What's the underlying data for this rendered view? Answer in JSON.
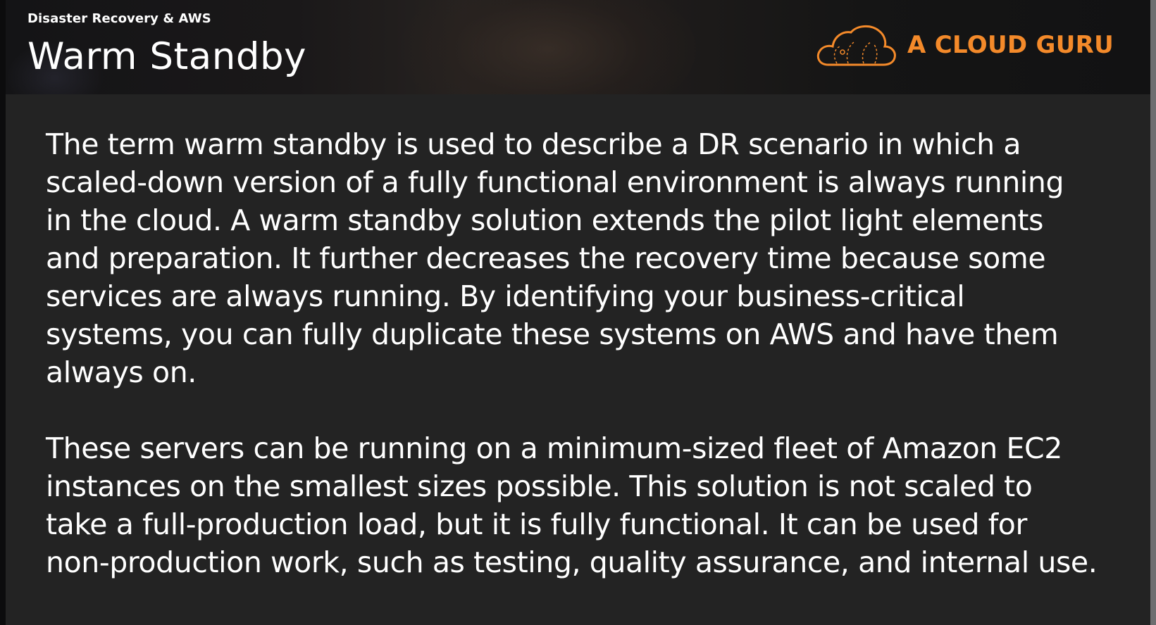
{
  "header": {
    "course": "Disaster Recovery & AWS",
    "title": "Warm Standby",
    "logo_text": "A CLOUD GURU",
    "logo_icon": "cloud-guru-icon",
    "brand_color": "#f48a2a"
  },
  "body": {
    "paragraphs": [
      "The term warm standby is used to describe a DR scenario in which a\nscaled-down version of a fully functional environment is always running\nin the cloud. A warm standby solution extends the pilot light elements\nand preparation. It further decreases the recovery time because some\nservices are always running. By identifying your business-critical\nsystems, you can fully duplicate these systems on AWS and have them\nalways on.",
      "These servers can be running on a minimum-sized fleet of Amazon EC2\ninstances on the smallest sizes possible. This solution is not scaled to\ntake a full-production load, but it is fully functional. It can be used for\nnon-production work, such as testing, quality assurance, and internal use."
    ]
  }
}
